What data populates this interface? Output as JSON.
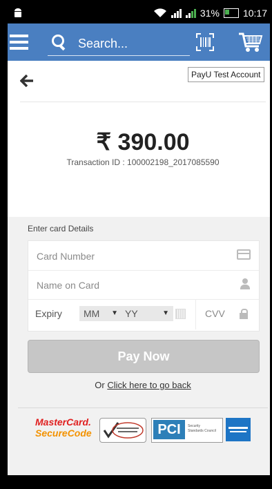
{
  "status_bar": {
    "battery": "31%",
    "time": "10:17"
  },
  "app_bar": {
    "search_placeholder": "Search...",
    "icons": [
      "menu-icon",
      "search-icon",
      "barcode-scan-icon",
      "cart-icon"
    ]
  },
  "header": {
    "account_badge": "PayU Test Account"
  },
  "transaction": {
    "amount": "₹ 390.00",
    "txn_id": "Transaction ID : 100002198_2017085590"
  },
  "card_form": {
    "title": "Enter card Details",
    "card_number_placeholder": "Card Number",
    "name_placeholder": "Name on Card",
    "expiry_label": "Expiry",
    "month_value": "MM",
    "year_value": "YY",
    "cvv_label": "CVV",
    "pay_button": "Pay Now",
    "go_back_prefix": "Or ",
    "go_back_link": "Click here to go back"
  },
  "security_logos": {
    "mastercard_line1": "MasterCard.",
    "mastercard_line2": "SecureCode",
    "pci_label": "PCI",
    "pci_text_1": "Security",
    "pci_text_2": "Standards Council"
  },
  "colors": {
    "app_bar": "#4a7fc1",
    "button_disabled": "#c6c6c6",
    "panel_bg": "#f1f1f1",
    "battery_green": "#4caf50"
  }
}
